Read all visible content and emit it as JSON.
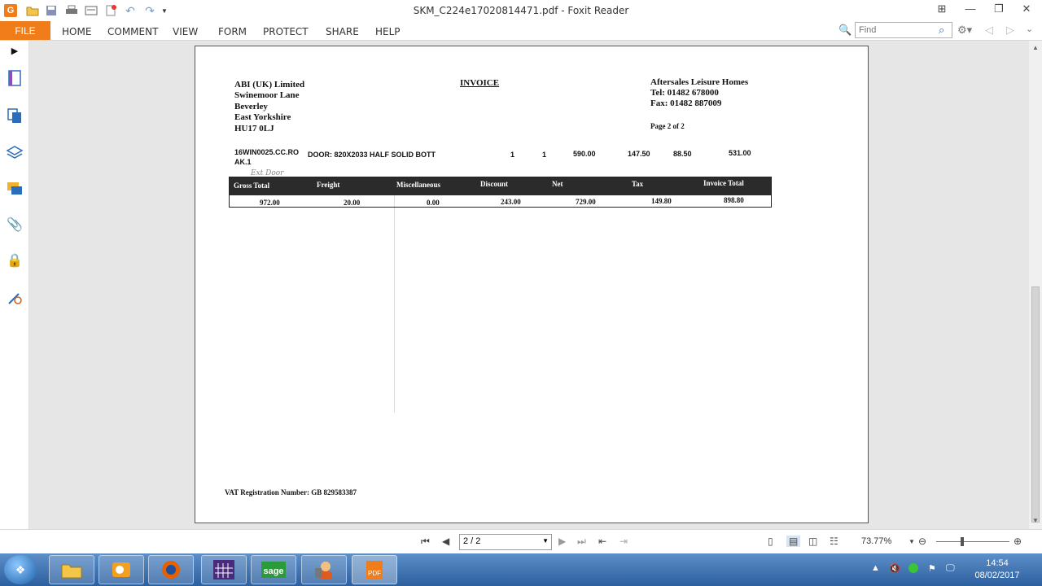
{
  "window": {
    "title": "SKM_C224e17020814471.pdf - Foxit Reader",
    "app_logo": "G"
  },
  "menu": {
    "file": "FILE",
    "items": [
      "HOME",
      "COMMENT",
      "VIEW",
      "FORM",
      "PROTECT",
      "SHARE",
      "HELP"
    ],
    "find_placeholder": "Find"
  },
  "document": {
    "seller": [
      "ABI (UK) Limited",
      "Swinemoor Lane",
      "Beverley",
      "East Yorkshire",
      "HU17 0LJ"
    ],
    "title": "INVOICE",
    "buyer": [
      "Aftersales Leisure Homes",
      "Tel: 01482 678000",
      "Fax: 01482 887009"
    ],
    "page_of": "Page 2 of 2",
    "line_item": {
      "code_line1": "16WIN0025.CC.RO",
      "code_line2": "AK.1",
      "description": "DOOR: 820X2033 HALF SOLID BOTT",
      "qty1": "1",
      "qty2": "1",
      "price": "590.00",
      "discount": "147.50",
      "tax": "88.50",
      "total": "531.00"
    },
    "handwritten_note": "Ext Door",
    "summary_headers": [
      "Gross Total",
      "Freight",
      "Miscellaneous",
      "Discount",
      "Net",
      "Tax",
      "Invoice Total"
    ],
    "summary_values": [
      "972.00",
      "20.00",
      "0.00",
      "243.00",
      "729.00",
      "149.80",
      "898.80"
    ],
    "vat": "VAT Registration Number: GB 829583387"
  },
  "statusbar": {
    "page_value": "2 / 2",
    "zoom": "73.77%"
  },
  "taskbar": {
    "time": "14:54",
    "date": "08/02/2017"
  },
  "icons": {
    "start": "windows-start-icon",
    "explorer": "folder-icon",
    "outlook": "outlook-icon",
    "firefox": "firefox-icon",
    "app4": "calculator-grid-icon",
    "sage": "sage-icon",
    "app6": "user-icon",
    "foxit": "foxit-pdf-icon"
  }
}
